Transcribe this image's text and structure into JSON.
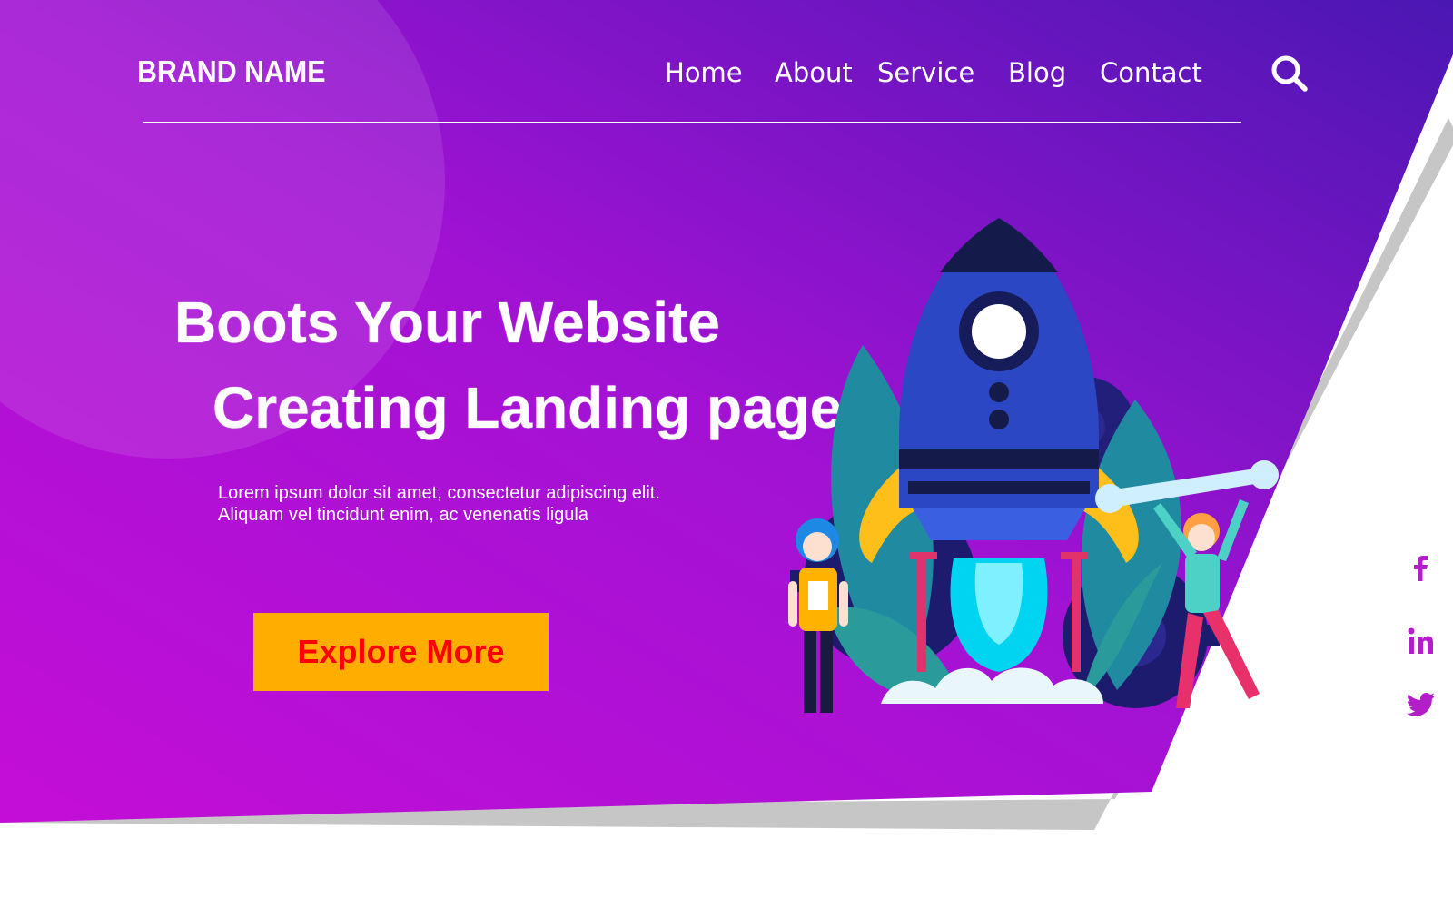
{
  "brand": {
    "name": "BRAND NAME"
  },
  "nav": {
    "items": [
      {
        "label": "Home"
      },
      {
        "label": "About"
      },
      {
        "label": "Service"
      },
      {
        "label": "Blog"
      },
      {
        "label": "Contact"
      }
    ],
    "search_icon": "search-icon"
  },
  "hero": {
    "title_line1": "Boots Your Website",
    "title_line2": "Creating Landing page",
    "text_line1": "Lorem ipsum dolor sit amet, consectetur adipiscing elit.",
    "text_line2": "Aliquam vel tincidunt enim, ac venenatis ligula",
    "cta_label": "Explore More"
  },
  "social": {
    "icons": [
      "facebook-icon",
      "linkedin-icon",
      "twitter-icon"
    ]
  },
  "colors": {
    "gradient_start": "#c20ed6",
    "gradient_end": "#4a16b4",
    "cta_background": "#ffae00",
    "cta_text": "#ff0000",
    "social_icon": "#b21fc9",
    "shadow_gray": "#c8c8c8",
    "text": "#ffffff"
  }
}
